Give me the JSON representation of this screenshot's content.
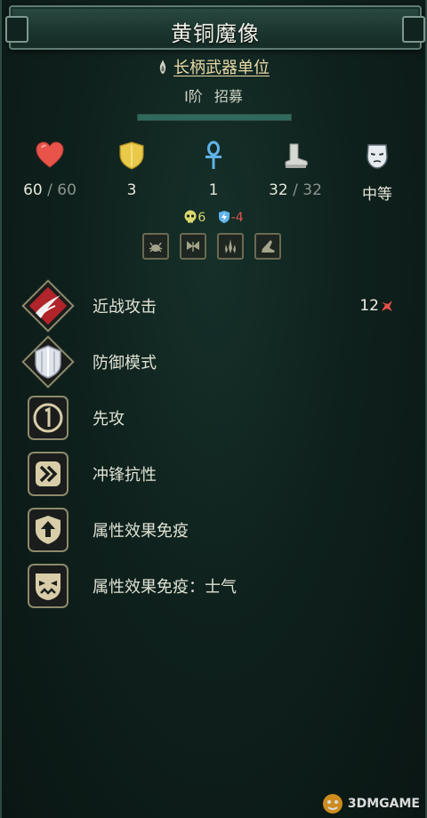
{
  "unit": {
    "name": "黄铜魔像",
    "type": "长柄武器单位",
    "tier": "I阶",
    "source": "招募",
    "xp_progress": 1.0
  },
  "stats": [
    {
      "icon": "heart-icon",
      "value": "60",
      "max": "60"
    },
    {
      "icon": "shield-icon",
      "value": "3",
      "max": ""
    },
    {
      "icon": "ankh-icon",
      "value": "1",
      "max": ""
    },
    {
      "icon": "boot-icon",
      "value": "32",
      "max": "32"
    },
    {
      "icon": "mask-icon",
      "value": "中等",
      "max": ""
    }
  ],
  "buffs": {
    "positive": "6",
    "negative": "-4"
  },
  "abilities": [
    {
      "label": "近战攻击",
      "value": "12",
      "icon": "melee-attack-icon"
    },
    {
      "label": "防御模式",
      "value": "",
      "icon": "defense-mode-icon"
    },
    {
      "label": "先攻",
      "value": "",
      "icon": "first-strike-icon"
    },
    {
      "label": "冲锋抗性",
      "value": "",
      "icon": "charge-resistance-icon"
    },
    {
      "label": "属性效果免疫",
      "value": "",
      "icon": "status-immunity-icon"
    },
    {
      "label": "属性效果免疫：士气",
      "value": "",
      "icon": "morale-immunity-icon"
    }
  ],
  "watermark": "3DMGAME",
  "colors": {
    "accent_gold": "#e9d9a6",
    "negative_red": "#e2524a",
    "positive_yellow": "#d9d870",
    "panel_bg": "#102420"
  }
}
